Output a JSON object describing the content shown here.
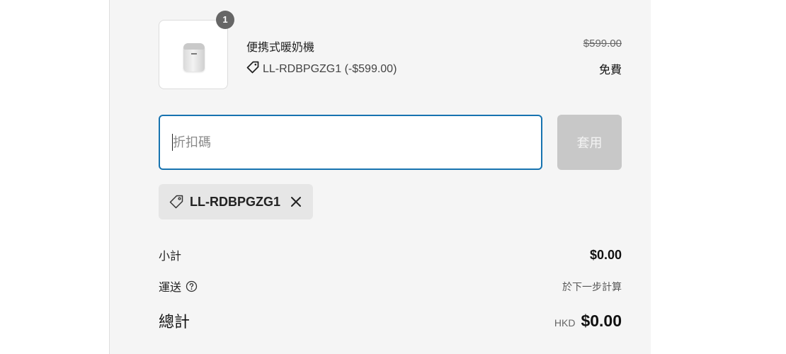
{
  "line_item": {
    "quantity": "1",
    "title": "便携式暖奶機",
    "discount_line": "LL-RDBPGZG1 (-$599.00)",
    "compare_price": "$599.00",
    "final_price": "免費",
    "thumbnail_icon": "bottle-warmer-image"
  },
  "discount": {
    "placeholder": "折扣碼",
    "value": "",
    "apply_label": "套用",
    "applied_code": "LL-RDBPGZG1"
  },
  "totals": {
    "subtotal_label": "小計",
    "subtotal_value": "$0.00",
    "shipping_label": "運送",
    "shipping_value": "於下一步計算",
    "total_label": "總計",
    "currency": "HKD",
    "total_value": "$0.00"
  },
  "colors": {
    "panel_bg": "#f5f5f5",
    "accent": "#1773b0",
    "apply_disabled": "#c8c8c8",
    "badge": "#666666"
  }
}
